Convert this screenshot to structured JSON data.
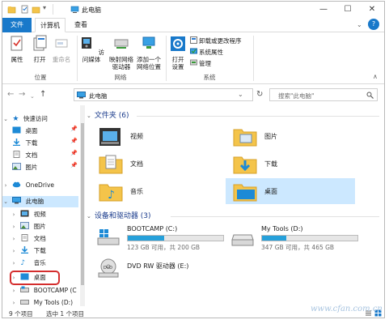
{
  "window": {
    "title": "此电脑"
  },
  "ribbon_tabs": {
    "file": "文件",
    "computer": "计算机",
    "view": "查看"
  },
  "ribbon": {
    "properties": "属性",
    "open": "打开",
    "rename": "重命名",
    "location_group": "位置",
    "access_media": [
      "访问媒体"
    ],
    "map_drive": [
      "映射网络",
      "驱动器"
    ],
    "add_location": [
      "添加一个",
      "网络位置"
    ],
    "network_group": "网络",
    "open_settings": [
      "打开",
      "设置"
    ],
    "uninstall": "卸载或更改程序",
    "system_properties": "系统属性",
    "manage": "管理",
    "system_group": "系统"
  },
  "address": {
    "path": "此电脑",
    "search_placeholder": "搜索\"此电脑\""
  },
  "sidebar": {
    "quick_access": "快速访问",
    "quick_items": [
      "桌面",
      "下载",
      "文档",
      "图片"
    ],
    "onedrive": "OneDrive",
    "this_pc": "此电脑",
    "pc_items": [
      "视频",
      "图片",
      "文档",
      "下载",
      "音乐",
      "桌面",
      "BOOTCAMP (C",
      "My Tools (D:)"
    ]
  },
  "folders": {
    "heading": "文件夹 (6)",
    "items": [
      "视频",
      "图片",
      "文档",
      "下载",
      "音乐",
      "桌面"
    ]
  },
  "drives": {
    "heading": "设备和驱动器 (3)",
    "items": [
      {
        "name": "BOOTCAMP (C:)",
        "size": "123 GB 可用，共 200 GB",
        "used_fraction": 0.385
      },
      {
        "name": "My Tools (D:)",
        "size": "347 GB 可用，共 465 GB",
        "used_fraction": 0.254
      },
      {
        "name": "DVD RW 驱动器 (E:)"
      }
    ]
  },
  "status": {
    "count": "9 个项目",
    "selected": "选中 1 个项目"
  },
  "watermark": "www.cfan.com.cn",
  "colors": {
    "accent": "#1979ca",
    "selection": "#cce8ff",
    "drive_fill": "#26a0da",
    "highlight": "#d42d2d"
  }
}
